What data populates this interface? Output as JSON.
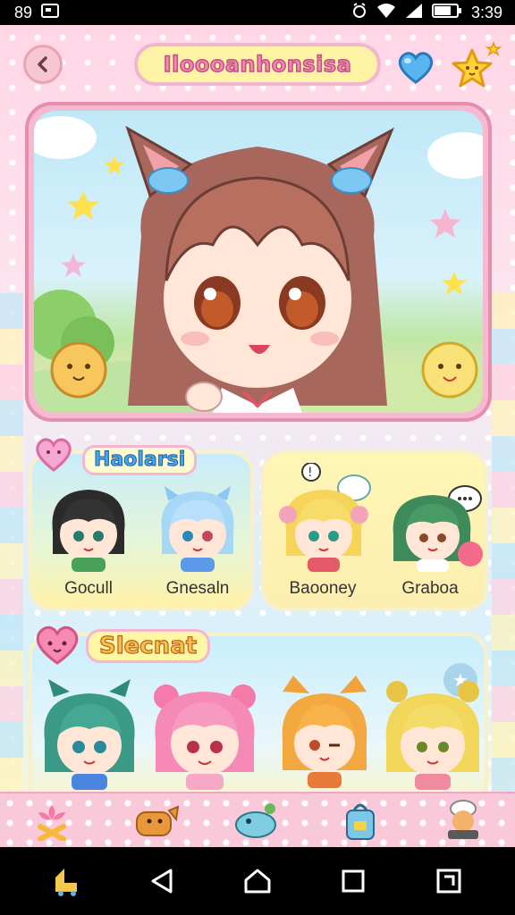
{
  "status_bar": {
    "left_text": "89",
    "time": "3:39",
    "icons": [
      "photo-icon",
      "alarm-icon",
      "wifi-icon",
      "signal-icon",
      "battery-icon"
    ]
  },
  "header": {
    "title": "Iloooanhonsisa",
    "back_icon": "chevron-left-icon",
    "heart_icon": "heart-icon",
    "star_icon": "star-icon"
  },
  "sections": {
    "first": {
      "label": "Haolarsi",
      "characters": [
        {
          "name": "Gocull",
          "icon": "black-hair-character-icon"
        },
        {
          "name": "Gnesaln",
          "icon": "blue-hair-character-icon"
        }
      ]
    },
    "second": {
      "characters": [
        {
          "name": "Baooney",
          "icon": "blonde-hair-character-icon"
        },
        {
          "name": "Graboa",
          "icon": "green-hair-character-icon"
        }
      ]
    },
    "third": {
      "label": "Slecnat",
      "characters": [
        {
          "name": "",
          "icon": "teal-hair-character-icon"
        },
        {
          "name": "",
          "icon": "pink-hair-character-icon"
        },
        {
          "name": "",
          "icon": "orange-hair-character-icon"
        },
        {
          "name": "",
          "icon": "yellow-hair-character-icon"
        }
      ]
    }
  },
  "tabbar": [
    "flower-icon",
    "dog-icon",
    "dino-icon",
    "backpack-icon",
    "chef-icon"
  ],
  "navbar": [
    "app-icon",
    "back-triangle-icon",
    "home-icon",
    "recent-icon",
    "screenshot-icon"
  ],
  "colors": {
    "pink": "#f7b9cf",
    "sky": "#bfe8f7",
    "yellow": "#fff3a6",
    "brown_hair": "#a86a5a"
  }
}
